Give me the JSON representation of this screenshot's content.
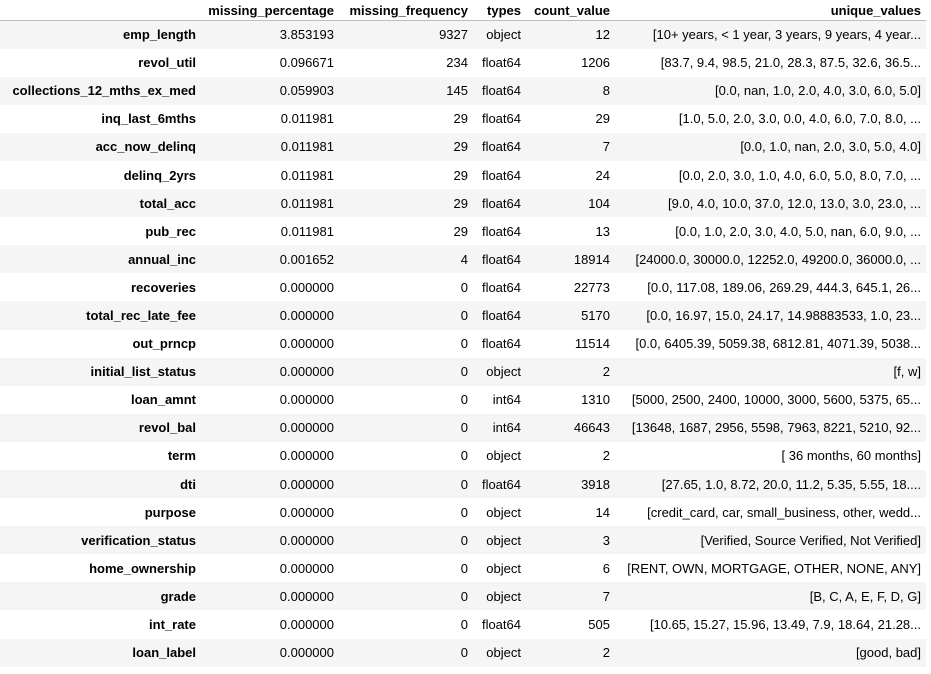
{
  "table": {
    "columns": [
      "",
      "missing_percentage",
      "missing_frequency",
      "types",
      "count_value",
      "unique_values"
    ],
    "rows": [
      [
        "emp_length",
        "3.853193",
        "9327",
        "object",
        "12",
        "[10+ years, < 1 year, 3 years, 9 years, 4 year..."
      ],
      [
        "revol_util",
        "0.096671",
        "234",
        "float64",
        "1206",
        "[83.7, 9.4, 98.5, 21.0, 28.3, 87.5, 32.6, 36.5..."
      ],
      [
        "collections_12_mths_ex_med",
        "0.059903",
        "145",
        "float64",
        "8",
        "[0.0, nan, 1.0, 2.0, 4.0, 3.0, 6.0, 5.0]"
      ],
      [
        "inq_last_6mths",
        "0.011981",
        "29",
        "float64",
        "29",
        "[1.0, 5.0, 2.0, 3.0, 0.0, 4.0, 6.0, 7.0, 8.0, ..."
      ],
      [
        "acc_now_delinq",
        "0.011981",
        "29",
        "float64",
        "7",
        "[0.0, 1.0, nan, 2.0, 3.0, 5.0, 4.0]"
      ],
      [
        "delinq_2yrs",
        "0.011981",
        "29",
        "float64",
        "24",
        "[0.0, 2.0, 3.0, 1.0, 4.0, 6.0, 5.0, 8.0, 7.0, ..."
      ],
      [
        "total_acc",
        "0.011981",
        "29",
        "float64",
        "104",
        "[9.0, 4.0, 10.0, 37.0, 12.0, 13.0, 3.0, 23.0, ..."
      ],
      [
        "pub_rec",
        "0.011981",
        "29",
        "float64",
        "13",
        "[0.0, 1.0, 2.0, 3.0, 4.0, 5.0, nan, 6.0, 9.0, ..."
      ],
      [
        "annual_inc",
        "0.001652",
        "4",
        "float64",
        "18914",
        "[24000.0, 30000.0, 12252.0, 49200.0, 36000.0, ..."
      ],
      [
        "recoveries",
        "0.000000",
        "0",
        "float64",
        "22773",
        "[0.0, 117.08, 189.06, 269.29, 444.3, 645.1, 26..."
      ],
      [
        "total_rec_late_fee",
        "0.000000",
        "0",
        "float64",
        "5170",
        "[0.0, 16.97, 15.0, 24.17, 14.98883533, 1.0, 23..."
      ],
      [
        "out_prncp",
        "0.000000",
        "0",
        "float64",
        "11514",
        "[0.0, 6405.39, 5059.38, 6812.81, 4071.39, 5038..."
      ],
      [
        "initial_list_status",
        "0.000000",
        "0",
        "object",
        "2",
        "[f, w]"
      ],
      [
        "loan_amnt",
        "0.000000",
        "0",
        "int64",
        "1310",
        "[5000, 2500, 2400, 10000, 3000, 5600, 5375, 65..."
      ],
      [
        "revol_bal",
        "0.000000",
        "0",
        "int64",
        "46643",
        "[13648, 1687, 2956, 5598, 7963, 8221, 5210, 92..."
      ],
      [
        "term",
        "0.000000",
        "0",
        "object",
        "2",
        "[ 36 months, 60 months]"
      ],
      [
        "dti",
        "0.000000",
        "0",
        "float64",
        "3918",
        "[27.65, 1.0, 8.72, 20.0, 11.2, 5.35, 5.55, 18...."
      ],
      [
        "purpose",
        "0.000000",
        "0",
        "object",
        "14",
        "[credit_card, car, small_business, other, wedd..."
      ],
      [
        "verification_status",
        "0.000000",
        "0",
        "object",
        "3",
        "[Verified, Source Verified, Not Verified]"
      ],
      [
        "home_ownership",
        "0.000000",
        "0",
        "object",
        "6",
        "[RENT, OWN, MORTGAGE, OTHER, NONE, ANY]"
      ],
      [
        "grade",
        "0.000000",
        "0",
        "object",
        "7",
        "[B, C, A, E, F, D, G]"
      ],
      [
        "int_rate",
        "0.000000",
        "0",
        "float64",
        "505",
        "[10.65, 15.27, 15.96, 13.49, 7.9, 18.64, 21.28..."
      ],
      [
        "loan_label",
        "0.000000",
        "0",
        "object",
        "2",
        "[good, bad]"
      ]
    ]
  },
  "colors": {
    "stripe": "#f5f5f5",
    "header_rule": "#bdbdbd",
    "text": "#000000"
  }
}
